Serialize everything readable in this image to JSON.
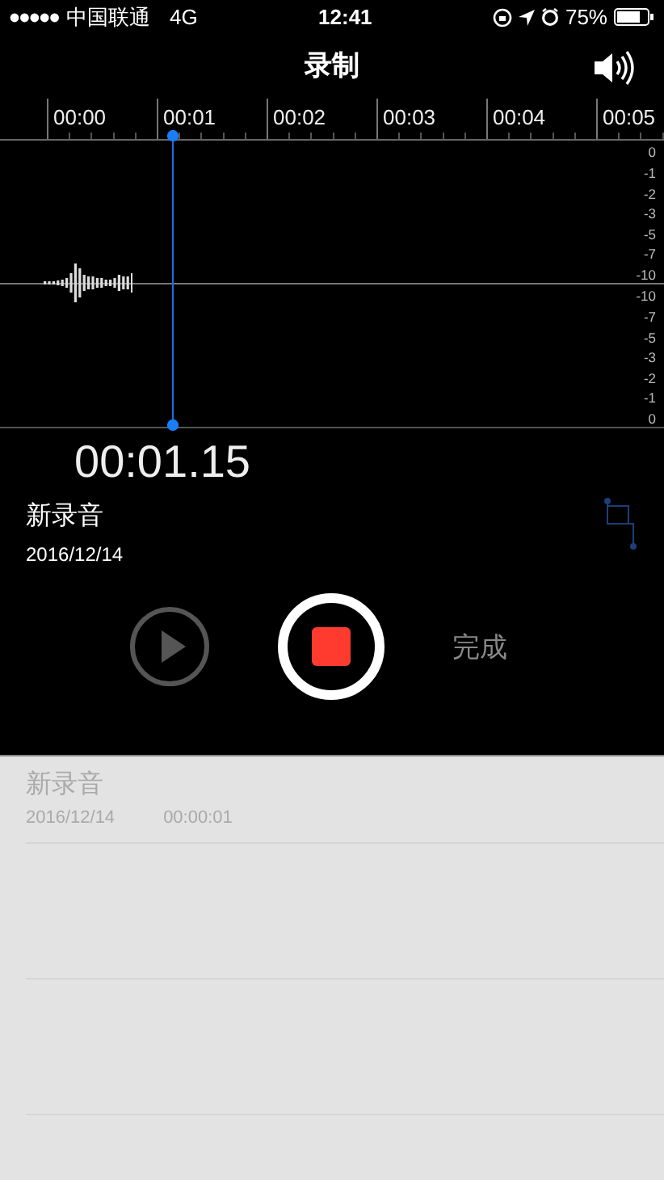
{
  "status_bar": {
    "carrier": "中国联通",
    "network": "4G",
    "time": "12:41",
    "battery": "75%"
  },
  "title": "录制",
  "ruler": {
    "ticks": [
      "00:00",
      "00:01",
      "00:02",
      "00:03",
      "00:04",
      "00:05"
    ]
  },
  "meter": {
    "upper": [
      "0",
      "-1",
      "-2",
      "-3",
      "-5",
      "-7",
      "-10"
    ],
    "lower": [
      "-10",
      "-7",
      "-5",
      "-3",
      "-2",
      "-1",
      "0"
    ]
  },
  "recording": {
    "elapsed": "00:01.15",
    "name": "新录音",
    "date": "2016/12/14"
  },
  "controls": {
    "play_disabled": true,
    "done": "完成"
  },
  "recordings": [
    {
      "name": "新录音",
      "date": "2016/12/14",
      "duration": "00:00:01"
    }
  ]
}
